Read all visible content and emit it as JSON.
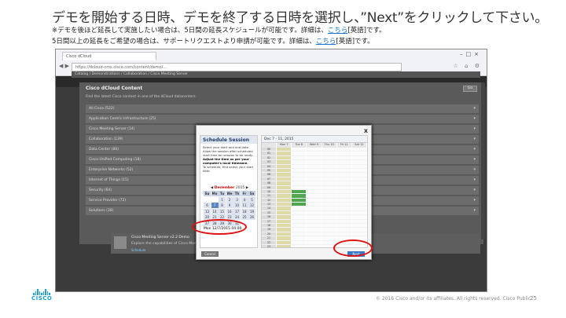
{
  "slide": {
    "title": "デモを開始する日時、デモを終了する日時を選択し、”Next”をクリックして下さい。",
    "note1_pre": "※デモを後ほど延長して実施したい場合は、5日間の延長スケジュールが可能です。詳細は、",
    "note1_link": "こちら",
    "note1_post": "[英語]です。",
    "note2_pre": "5日間以上の延長をご希望の場合は、サポートリクエストより申請が可能です。詳細は、",
    "note2_link": "こちら",
    "note2_post": "[英語]です。"
  },
  "browser": {
    "tab_label": "Cisco dCloud",
    "address": "https://dcloud-cms.cisco.com/content/demo/...",
    "win_buttons": "–□×"
  },
  "page": {
    "breadcrumbs": "Catalog / Demonstrations / Collaboration / Cisco Meeting Server",
    "content_title": "Cisco dCloud Content",
    "content_subtitle": "Find the latest Cisco content in one of the dCloud datacenters",
    "search_label": "Go",
    "rows": [
      "All Cisco (522)",
      "Application Centric Infrastructure (25)",
      "Cisco Meeting Server (14)",
      "Collaboration (139)",
      "Data Center (86)",
      "Cisco Unified Computing (18)",
      "Enterprise Networks (52)",
      "Internet of Things (15)",
      "Security (64)",
      "Service Provider (72)",
      "Solutions (38)"
    ],
    "session_title": "Cisco Meeting Server v2.2 Demo",
    "session_desc": "Explore the capabilities of Cisco Meeting Server",
    "session_link": "Schedule"
  },
  "modal": {
    "close": "x",
    "header": "Schedule Session",
    "help_text": "Select your start and end date. Allow the session after scheduled start time for session to be ready.",
    "help_bold": "Adjust the time as per your computer's local timezone.",
    "help_extra": "To schedule, first select your start date.",
    "month": "December",
    "year": "2015",
    "dow": [
      "Su",
      "Mo",
      "Tu",
      "We",
      "Th",
      "Fr",
      "Sa"
    ],
    "days": [
      "",
      "",
      "1",
      "2",
      "3",
      "4",
      "5",
      "6",
      "7",
      "8",
      "9",
      "10",
      "11",
      "12",
      "13",
      "14",
      "15",
      "16",
      "17",
      "18",
      "19",
      "20",
      "21",
      "22",
      "23",
      "24",
      "25",
      "26",
      "27",
      "28",
      "29",
      "30",
      "31",
      "",
      ""
    ],
    "selected_day": "7",
    "time_value": "Mon 12/7/2015   04:00",
    "cancel_label": "Cancel",
    "next_label": "Next",
    "schedule_range": "Dec 7 - 11, 2015",
    "schedule_days": [
      "",
      "Mon 7",
      "Tue 8",
      "Wed 9",
      "Thu 10",
      "Fri 11",
      "Sat 12"
    ],
    "hours": [
      "00",
      "01",
      "02",
      "03",
      "04",
      "05",
      "06",
      "07",
      "08",
      "09",
      "10",
      "11",
      "12",
      "13",
      "14",
      "15",
      "16",
      "17",
      "18",
      "19",
      "20",
      "21",
      "22",
      "23"
    ]
  },
  "footer": {
    "logo": "CISCO",
    "copyright": "© 2016 Cisco and/or its affiliates. All rights reserved.    Cisco Public",
    "page_number": "25"
  },
  "colors": {
    "highlight_ring": "#e01010",
    "link": "#1a73c8",
    "brand": "#1ba0d7",
    "next_button": "#3a78c2"
  }
}
